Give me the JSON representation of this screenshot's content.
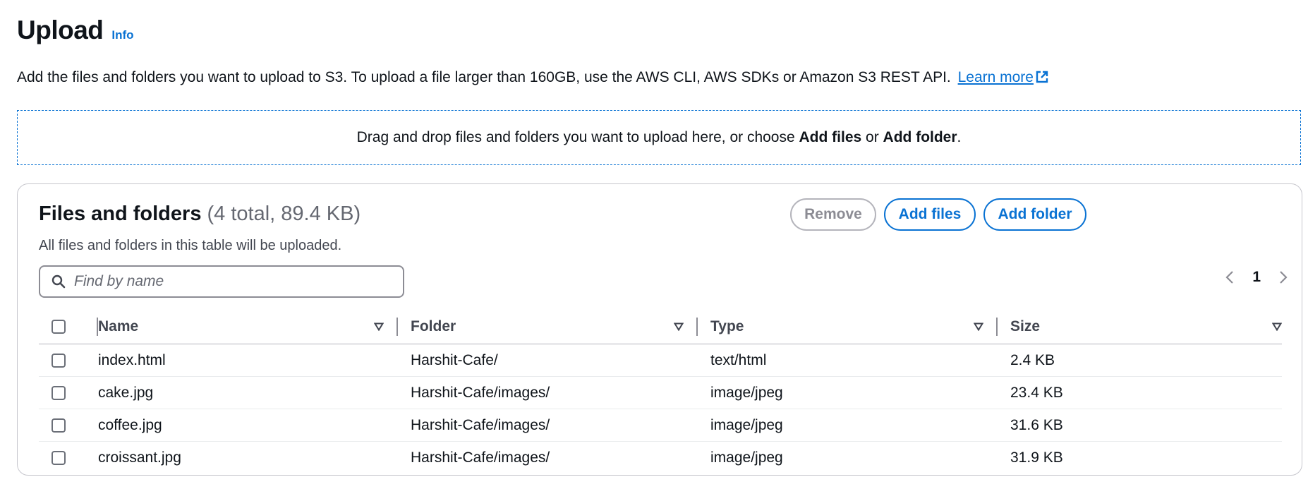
{
  "header": {
    "title": "Upload",
    "info_label": "Info"
  },
  "description": {
    "text": "Add the files and folders you want to upload to S3. To upload a file larger than 160GB, use the AWS CLI, AWS SDKs or Amazon S3 REST API.",
    "learn_more": "Learn more"
  },
  "dropzone": {
    "prefix": "Drag and drop files and folders you want to upload here, or choose ",
    "add_files": "Add files",
    "or": " or ",
    "add_folder": "Add folder",
    "suffix": "."
  },
  "panel": {
    "title": "Files and folders",
    "count": "(4 total, 89.4 KB)",
    "subtitle": "All files and folders in this table will be uploaded.",
    "buttons": {
      "remove": "Remove",
      "add_files": "Add files",
      "add_folder": "Add folder"
    },
    "search": {
      "placeholder": "Find by name",
      "value": ""
    },
    "pagination": {
      "current_page": "1"
    }
  },
  "table": {
    "columns": [
      "Name",
      "Folder",
      "Type",
      "Size"
    ],
    "rows": [
      {
        "name": "index.html",
        "folder": "Harshit-Cafe/",
        "type": "text/html",
        "size": "2.4 KB"
      },
      {
        "name": "cake.jpg",
        "folder": "Harshit-Cafe/images/",
        "type": "image/jpeg",
        "size": "23.4 KB"
      },
      {
        "name": "coffee.jpg",
        "folder": "Harshit-Cafe/images/",
        "type": "image/jpeg",
        "size": "31.6 KB"
      },
      {
        "name": "croissant.jpg",
        "folder": "Harshit-Cafe/images/",
        "type": "image/jpeg",
        "size": "31.9 KB"
      }
    ]
  },
  "colors": {
    "accent": "#0972d3",
    "text": "#0f141a",
    "muted": "#656871",
    "border": "#c6c6cd"
  },
  "icons": [
    "external-link-icon",
    "search-icon",
    "chevron-left-icon",
    "chevron-right-icon",
    "sort-caret-icon"
  ]
}
